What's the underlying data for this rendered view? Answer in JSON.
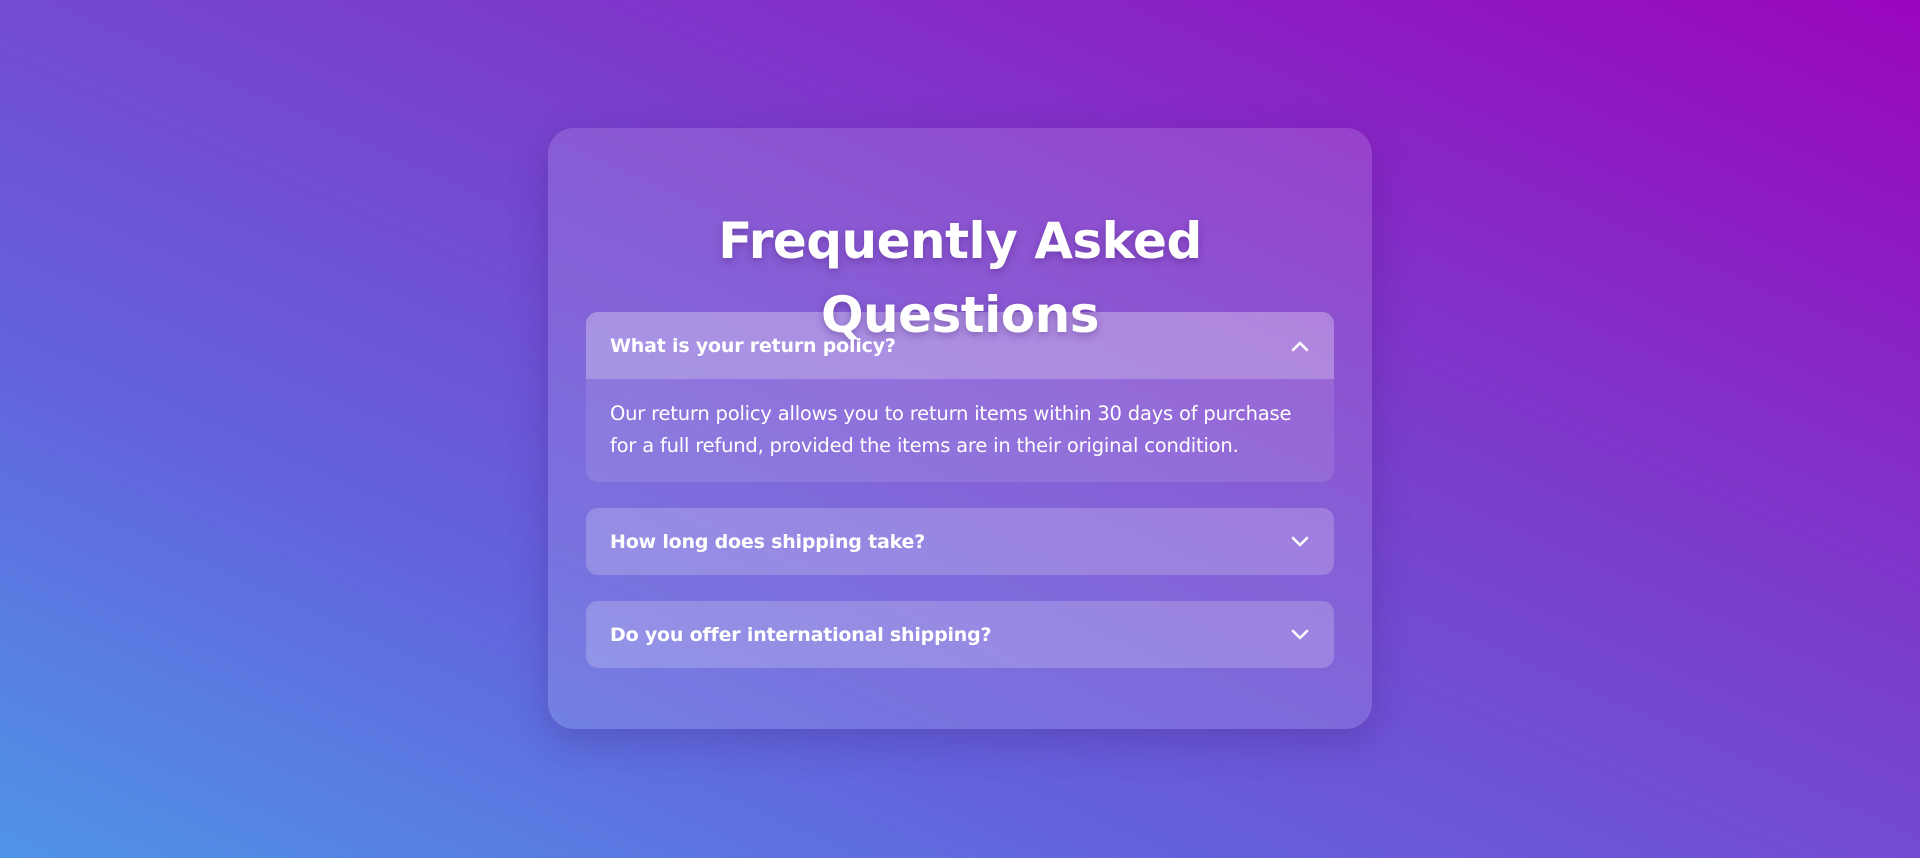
{
  "page": {
    "title": "Frequently Asked Questions"
  },
  "faq": {
    "items": [
      {
        "question": "What is your return policy?",
        "answer": "Our return policy allows you to return items within 30 days of purchase for a full refund, provided the items are in their original condition.",
        "expanded": true,
        "icon": "chevron-up-icon"
      },
      {
        "question": "How long does shipping take?",
        "expanded": false,
        "icon": "chevron-down-icon"
      },
      {
        "question": "Do you offer international shipping?",
        "expanded": false,
        "icon": "chevron-down-icon"
      }
    ]
  },
  "colors": {
    "background_start": "#4f94e8",
    "background_end": "#9a05bd",
    "text": "#ffffff"
  }
}
